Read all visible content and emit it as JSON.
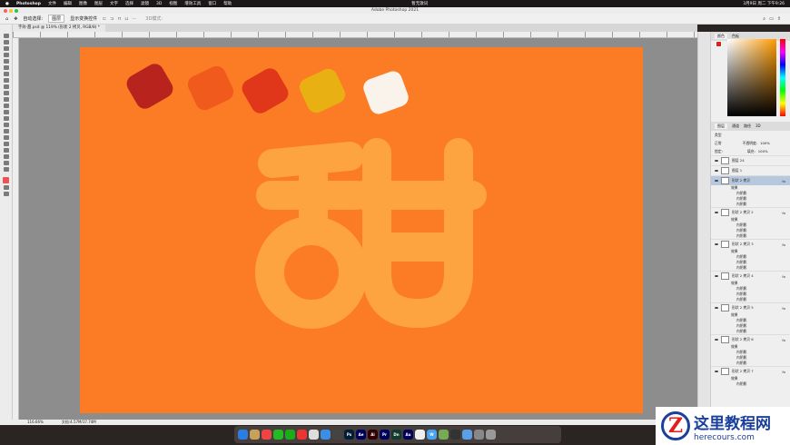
{
  "menubar": {
    "app": "Photoshop",
    "items": [
      "文件",
      "编辑",
      "图像",
      "图层",
      "文字",
      "选择",
      "滤镜",
      "3D",
      "视图",
      "增效工具",
      "窗口",
      "帮助"
    ],
    "center": "暂无歌词",
    "datetime": "3月9日 周二 下午9:26"
  },
  "window": {
    "title": "Adobe Photoshop 2021"
  },
  "options": {
    "auto_select": "自动选择:",
    "select_value": "图层",
    "show_transform": "显示变换控件",
    "mode_3d": "3D模式:"
  },
  "document": {
    "tab": "字效-甜.psd @ 119% (形状 2 拷贝, RGB/8) *",
    "colors": {
      "background": "#fb7c24",
      "glyph": "#fda33f"
    },
    "swatches": [
      "#b8231e",
      "#f05a1c",
      "#e0361a",
      "#e8b012",
      "#faf3ec"
    ]
  },
  "status": {
    "zoom": "116.66%",
    "doc_size": "文档:4.57M/17.74M"
  },
  "color_panel": {
    "tabs": [
      "颜色",
      "色板"
    ]
  },
  "layers_panel": {
    "tabs": [
      "图层",
      "通道",
      "路径",
      "3D"
    ],
    "filter": "类型",
    "blend": "正常",
    "opacity_label": "不透明度:",
    "opacity": "100%",
    "lock_label": "锁定:",
    "fill_label": "填充:",
    "fill": "100%",
    "layers": [
      {
        "name": "图层 24",
        "effects": []
      },
      {
        "name": "图层 1",
        "effects": []
      },
      {
        "name": "形状 2 拷贝",
        "selected": true,
        "fx": "fx",
        "group": "效果",
        "effects": [
          "内阴影",
          "内阴影",
          "内阴影"
        ]
      },
      {
        "name": "形状 2 拷贝 2",
        "fx": "fx",
        "group": "效果",
        "effects": [
          "内阴影",
          "内阴影",
          "内阴影"
        ]
      },
      {
        "name": "形状 2 拷贝 3",
        "fx": "fx",
        "group": "效果",
        "effects": [
          "内阴影",
          "内阴影",
          "内阴影"
        ]
      },
      {
        "name": "形状 2 拷贝 4",
        "fx": "fx",
        "group": "效果",
        "effects": [
          "内阴影",
          "内阴影",
          "内阴影"
        ]
      },
      {
        "name": "形状 2 拷贝 5",
        "fx": "fx",
        "group": "效果",
        "effects": [
          "内阴影",
          "内阴影",
          "内阴影"
        ]
      },
      {
        "name": "形状 2 拷贝 6",
        "fx": "fx",
        "group": "效果",
        "effects": [
          "内阴影",
          "内阴影",
          "内阴影"
        ]
      },
      {
        "name": "形状 2 拷贝 7",
        "fx": "fx",
        "group": "效果",
        "effects": [
          "内阴影"
        ]
      }
    ]
  },
  "dock": [
    {
      "label": "",
      "color": "#2a7de1"
    },
    {
      "label": "",
      "color": "#c8a05a"
    },
    {
      "label": "",
      "color": "#e44"
    },
    {
      "label": "",
      "color": "#2b2"
    },
    {
      "label": "",
      "color": "#1aad19"
    },
    {
      "label": "",
      "color": "#e33"
    },
    {
      "label": "",
      "color": "#ddd"
    },
    {
      "label": "",
      "color": "#3a8ee6"
    },
    {
      "label": "",
      "color": "#444"
    },
    {
      "label": "Ps",
      "color": "#001e36"
    },
    {
      "label": "Ae",
      "color": "#00005b"
    },
    {
      "label": "Ai",
      "color": "#330000"
    },
    {
      "label": "Pr",
      "color": "#00005b"
    },
    {
      "label": "Dn",
      "color": "#0e3b2e"
    },
    {
      "label": "Au",
      "color": "#00005b"
    },
    {
      "label": "",
      "color": "#eee"
    },
    {
      "label": "W",
      "color": "#49a3f2"
    },
    {
      "label": "",
      "color": "#7a5"
    },
    {
      "label": "",
      "color": "#333"
    },
    {
      "label": "",
      "color": "#5aa0e8"
    },
    {
      "label": "",
      "color": "#888"
    },
    {
      "label": "",
      "color": "#999"
    }
  ],
  "watermark": {
    "logo": "Z",
    "title": "这里教程网",
    "url": "herecours.com"
  }
}
